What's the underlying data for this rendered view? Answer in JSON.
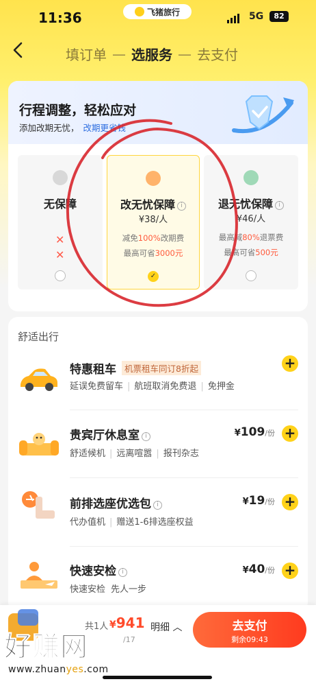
{
  "status_bar": {
    "time": "11:36",
    "app_name": "飞猪旅行",
    "network": "5G",
    "battery": "82"
  },
  "nav": {
    "back_icon": "chevron-left-icon",
    "steps": [
      "填订单",
      "选服务",
      "去支付"
    ],
    "separator": "—",
    "current_step": 1
  },
  "insurance": {
    "title": "行程调整，轻松应对",
    "subtitle": "添加改期无忧，",
    "subtitle_link": "改期更省钱",
    "plans": [
      {
        "name": "无保障",
        "selected": false,
        "icon": "no-shield-icon"
      },
      {
        "name": "改无忧保障",
        "price": "¥38/人",
        "line1_pre": "减免",
        "line1_em": "100%",
        "line1_post": "改期费",
        "line2_pre": "最高可省",
        "line2_em": "3000元",
        "selected": true,
        "icon": "orange-medal-icon"
      },
      {
        "name": "退无忧保障",
        "price": "¥46/人",
        "line1_pre": "最高减",
        "line1_em": "80%",
        "line1_post": "退票费",
        "line2_pre": "最高可省",
        "line2_em": "500元",
        "selected": false,
        "icon": "green-medal-icon"
      }
    ]
  },
  "comfort": {
    "title": "舒适出行",
    "services": [
      {
        "name": "特惠租车",
        "tag": "机票租车同订8折起",
        "desc": [
          "延误免费留车",
          "航班取消免费退",
          "免押金"
        ],
        "price": "",
        "icon": "car-icon"
      },
      {
        "name": "贵宾厅休息室",
        "desc": [
          "舒适候机",
          "远离喧嚣",
          "报刊杂志"
        ],
        "currency": "¥",
        "price": "109",
        "unit": "/份",
        "icon": "lounge-sofa-icon"
      },
      {
        "name": "前排选座优选包",
        "desc": [
          "代办值机",
          "赠送1-6排选座权益"
        ],
        "currency": "¥",
        "price": "19",
        "unit": "/份",
        "icon": "seat-icon"
      },
      {
        "name": "快速安检",
        "desc": [
          "快速安检",
          "先人一步"
        ],
        "currency": "¥",
        "price": "40",
        "unit": "/份",
        "icon": "security-check-icon"
      }
    ]
  },
  "bottom": {
    "pax": "共1人",
    "currency": "¥",
    "total": "941",
    "detail": "明细",
    "date": "/17",
    "pay_label": "去支付",
    "countdown": "剩余09:43"
  },
  "watermark": {
    "text": "好赚网",
    "url_pre": "www.zhuan",
    "url_em": "yes",
    "url_post": ".com"
  }
}
